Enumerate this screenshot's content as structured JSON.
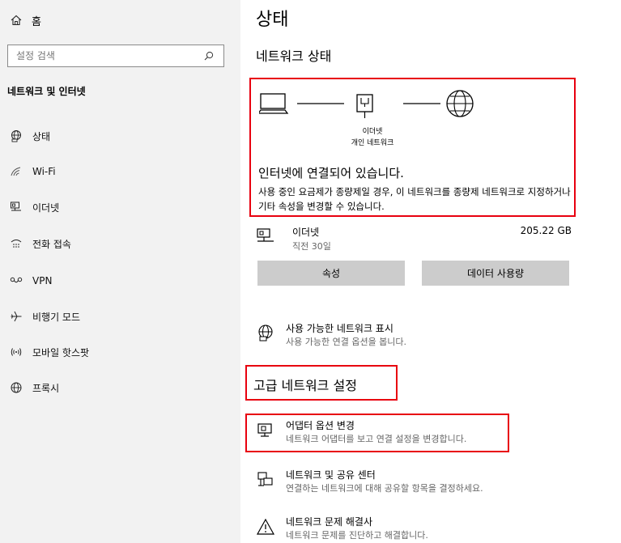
{
  "sidebar": {
    "home_label": "홈",
    "search_placeholder": "설정 검색",
    "section_title": "네트워크 및 인터넷",
    "items": [
      {
        "label": "상태",
        "icon": "status-globe-icon"
      },
      {
        "label": "Wi-Fi",
        "icon": "wifi-icon"
      },
      {
        "label": "이더넷",
        "icon": "ethernet-icon"
      },
      {
        "label": "전화 접속",
        "icon": "dialup-icon"
      },
      {
        "label": "VPN",
        "icon": "vpn-icon"
      },
      {
        "label": "비행기 모드",
        "icon": "airplane-icon"
      },
      {
        "label": "모바일 핫스팟",
        "icon": "hotspot-icon"
      },
      {
        "label": "프록시",
        "icon": "proxy-globe-icon"
      }
    ]
  },
  "main": {
    "page_title": "상태",
    "section_network_status": "네트워크 상태",
    "diagram": {
      "ethernet_label": "이더넷",
      "network_label": "개인 네트워크"
    },
    "connected_text": "인터넷에 연결되어 있습니다.",
    "status_description": "사용 중인 요금제가 종량제일 경우, 이 네트워크를 종량제 네트워크로 지정하거나 기타 속성을 변경할 수 있습니다.",
    "ethernet": {
      "name": "이더넷",
      "sub": "직전 30일",
      "size": "205.22 GB"
    },
    "buttons": {
      "properties": "속성",
      "data_usage": "데이터 사용량"
    },
    "show_networks": {
      "title": "사용 가능한 네트워크 표시",
      "sub": "사용 가능한 연결 옵션을 봅니다."
    },
    "advanced_title": "고급 네트워크 설정",
    "adapter_options": {
      "title": "어댑터 옵션 변경",
      "sub": "네트워크 어댑터를 보고 연결 설정을 변경합니다."
    },
    "sharing_center": {
      "title": "네트워크 및 공유 센터",
      "sub": "연결하는 네트워크에 대해 공유할 항목을 결정하세요."
    },
    "troubleshooter": {
      "title": "네트워크 문제 해결사",
      "sub": "네트워크 문제를 진단하고 해결합니다."
    }
  },
  "colors": {
    "highlight": "#e8000f",
    "sidebar_bg": "#f2f2f2",
    "button_bg": "#cccccc"
  }
}
